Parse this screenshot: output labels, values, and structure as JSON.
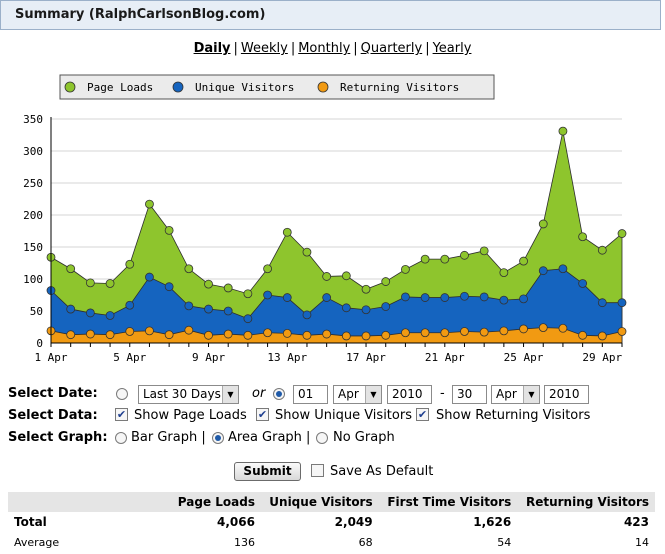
{
  "header": {
    "title": "Summary (RalphCarlsonBlog.com)"
  },
  "periods": [
    "Daily",
    "Weekly",
    "Monthly",
    "Quarterly",
    "Yearly"
  ],
  "chart_data": {
    "type": "area",
    "legend": [
      "Page Loads",
      "Unique Visitors",
      "Returning Visitors"
    ],
    "colors": [
      "#8ec52d",
      "#1564bf",
      "#f19a12"
    ],
    "ylim": [
      0,
      350
    ],
    "yticks": [
      0,
      50,
      100,
      150,
      200,
      250,
      300,
      350
    ],
    "xtick_labels": [
      "1 Apr",
      "5 Apr",
      "9 Apr",
      "13 Apr",
      "17 Apr",
      "21 Apr",
      "25 Apr",
      "29 Apr"
    ],
    "x": [
      "1 Apr",
      "2 Apr",
      "3 Apr",
      "4 Apr",
      "5 Apr",
      "6 Apr",
      "7 Apr",
      "8 Apr",
      "9 Apr",
      "10 Apr",
      "11 Apr",
      "12 Apr",
      "13 Apr",
      "14 Apr",
      "15 Apr",
      "16 Apr",
      "17 Apr",
      "18 Apr",
      "19 Apr",
      "20 Apr",
      "21 Apr",
      "22 Apr",
      "23 Apr",
      "24 Apr",
      "25 Apr",
      "26 Apr",
      "27 Apr",
      "28 Apr",
      "29 Apr",
      "30 Apr"
    ],
    "series": [
      {
        "name": "Page Loads",
        "values": [
          134,
          116,
          94,
          93,
          123,
          217,
          176,
          116,
          92,
          86,
          77,
          116,
          173,
          142,
          104,
          105,
          84,
          96,
          115,
          131,
          131,
          137,
          144,
          110,
          128,
          186,
          331,
          166,
          145,
          171
        ]
      },
      {
        "name": "Unique Visitors",
        "values": [
          82,
          53,
          47,
          43,
          59,
          103,
          88,
          58,
          53,
          50,
          38,
          75,
          71,
          44,
          71,
          55,
          52,
          57,
          72,
          71,
          71,
          73,
          72,
          67,
          69,
          113,
          116,
          93,
          63,
          63
        ]
      },
      {
        "name": "Returning Visitors",
        "values": [
          19,
          13,
          14,
          13,
          18,
          19,
          13,
          20,
          12,
          14,
          12,
          16,
          15,
          12,
          14,
          11,
          11,
          12,
          16,
          16,
          16,
          18,
          17,
          19,
          22,
          24,
          23,
          12,
          11,
          18
        ]
      }
    ]
  },
  "form": {
    "select_date_label": "Select Date:",
    "range_value": "Last 30 Days",
    "or_text": "or",
    "from_day": "01",
    "from_month": "Apr",
    "from_year": "2010",
    "dash": "-",
    "to_day": "30",
    "to_month": "Apr",
    "to_year": "2010",
    "select_data_label": "Select Data:",
    "show_page_loads": "Show Page Loads",
    "show_unique": "Show Unique Visitors",
    "show_returning": "Show Returning Visitors",
    "select_graph_label": "Select Graph:",
    "bar_graph": "Bar Graph |",
    "area_graph": "Area Graph |",
    "no_graph": "No Graph",
    "submit": "Submit",
    "save_default": "Save As Default"
  },
  "table": {
    "headers": [
      "",
      "Page Loads",
      "Unique Visitors",
      "First Time Visitors",
      "Returning Visitors"
    ],
    "total": [
      "Total",
      "4,066",
      "2,049",
      "1,626",
      "423"
    ],
    "average": [
      "Average",
      "136",
      "68",
      "54",
      "14"
    ]
  }
}
